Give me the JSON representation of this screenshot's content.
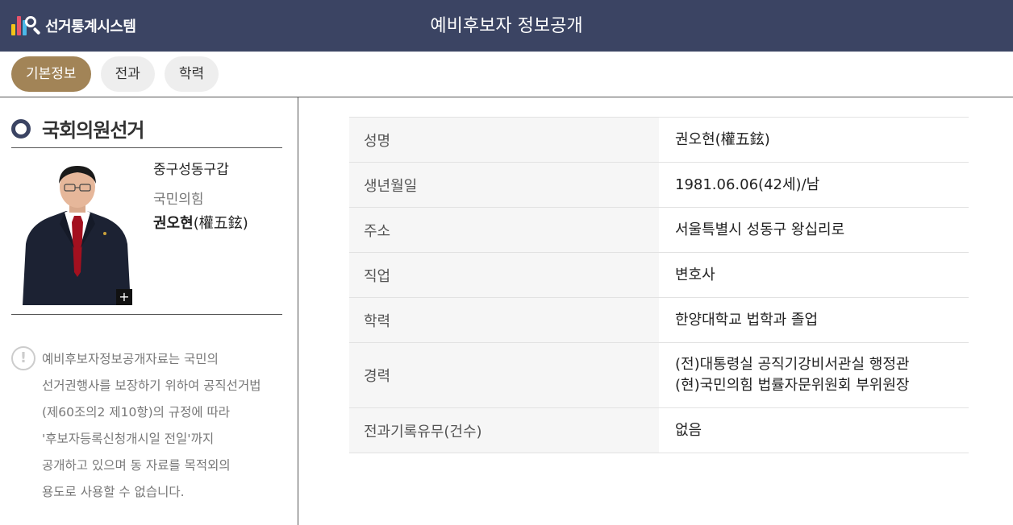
{
  "header": {
    "logo_text": "선거통계시스템",
    "title": "예비후보자 정보공개",
    "bg_color": "#3b4463"
  },
  "tabs": [
    {
      "label": "기본정보",
      "active": true
    },
    {
      "label": "전과",
      "active": false
    },
    {
      "label": "학력",
      "active": false
    }
  ],
  "accent_color": "#a28457",
  "election": {
    "title": "국회의원선거",
    "icon": "ring-icon"
  },
  "candidate": {
    "district": "중구성동구갑",
    "party": "국민의힘",
    "name": "권오현",
    "name_hanja": "(權五鉉)",
    "photo_expand_icon": "plus-icon"
  },
  "notice": {
    "icon": "exclamation-icon",
    "lines": [
      "예비후보자정보공개자료는 국민의",
      "선거권행사를 보장하기 위하여 공직선거법",
      "(제60조의2 제10항)의 규정에 따라",
      "'후보자등록신청개시일 전일'까지",
      "공개하고 있으며 동 자료를 목적외의",
      "용도로 사용할 수 없습니다."
    ]
  },
  "info_table": [
    {
      "label": "성명",
      "lines": [
        "권오현(權五鉉)"
      ]
    },
    {
      "label": "생년월일",
      "lines": [
        "1981.06.06(42세)/남"
      ]
    },
    {
      "label": "주소",
      "lines": [
        "서울특별시 성동구 왕십리로"
      ]
    },
    {
      "label": "직업",
      "lines": [
        "변호사"
      ]
    },
    {
      "label": "학력",
      "lines": [
        "한양대학교 법학과 졸업"
      ]
    },
    {
      "label": "경력",
      "lines": [
        "(전)대통령실 공직기강비서관실 행정관",
        "(현)국민의힘 법률자문위원회 부위원장"
      ]
    },
    {
      "label": "전과기록유무(건수)",
      "lines": [
        "없음"
      ]
    }
  ]
}
